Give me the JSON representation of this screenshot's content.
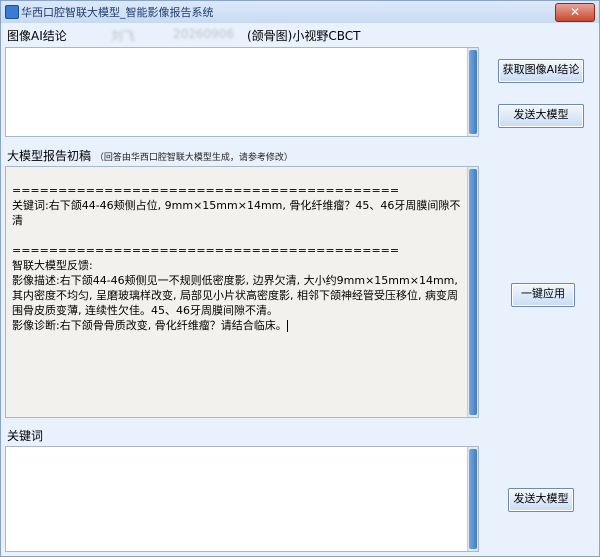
{
  "window": {
    "title": "华西口腔智联大模型_智能影像报告系统",
    "close_label": "✕"
  },
  "image_section": {
    "label": "图像AI结论",
    "patient_name": "刘飞",
    "patient_id": "20260906",
    "scan_type": "(颌骨图)小视野CBCT",
    "ai_conclusion": ""
  },
  "buttons": {
    "get_ai_conclusion": "获取图像AI结论",
    "send_model_top": "发送大模型",
    "apply_one_click": "一键应用",
    "send_model_bottom": "发送大模型"
  },
  "report_section": {
    "label": "大模型报告初稿",
    "note": "（回答由华西口腔智联大模型生成，请参考修改）",
    "separator_1": "==========================================",
    "keywords_line": "关键词:右下颌44-46颊侧占位, 9mm×15mm×14mm, 骨化纤维瘤？45、46牙周膜间隙不清",
    "separator_2": "==========================================",
    "feedback_header": "智联大模型反馈:",
    "description": "影像描述:右下颌44-46颊侧见一不规则低密度影, 边界欠清, 大小约9mm×15mm×14mm, 其内密度不均匀, 呈磨玻璃样改变, 局部见小片状高密度影, 相邻下颌神经管受压移位, 病变周围骨皮质变薄, 连续性欠佳。45、46牙周膜间隙不清。",
    "diagnosis": "影像诊断:右下颌骨骨质改变, 骨化纤维瘤？请结合临床。"
  },
  "keywords_section": {
    "label": "关键词",
    "value": ""
  }
}
